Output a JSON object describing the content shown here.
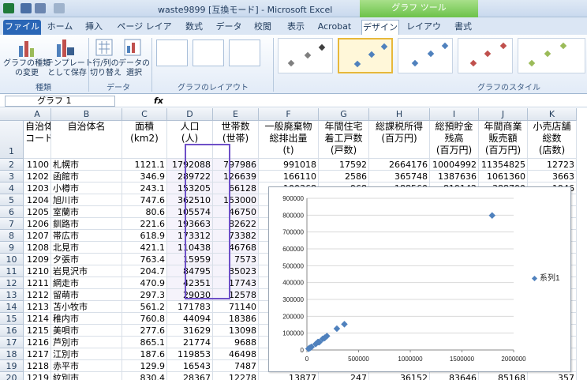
{
  "window": {
    "title": "waste9899 [互換モード] - Microsoft Excel",
    "chart_tools": "グラフ ツール"
  },
  "tabs": [
    "ファイル",
    "ホーム",
    "挿入",
    "ページ レイアウト",
    "数式",
    "データ",
    "校閲",
    "表示",
    "Acrobat",
    "デザイン",
    "レイアウト",
    "書式"
  ],
  "ribbon": {
    "change_type": "グラフの種類\nの変更",
    "save_template": "テンプレート\nとして保存",
    "type_group": "種類",
    "switch_rowcol": "行/列の\n切り替え",
    "select_data": "データの\n選択",
    "data_group": "データ",
    "layout_group": "グラフのレイアウト",
    "style_group": "グラフのスタイル"
  },
  "formula_bar": {
    "name_box": "グラフ 1",
    "fx": "fx"
  },
  "columns": [
    "A",
    "B",
    "C",
    "D",
    "E",
    "F",
    "G",
    "H",
    "I",
    "J",
    "K"
  ],
  "header_row": [
    "自治体\nコード",
    "自治体名",
    "面積\n(km2)",
    "人口\n(人)",
    "世帯数\n(世帯)",
    "一般廃棄物\n総排出量\n(t)",
    "年間住宅\n着工戸数\n(戸数)",
    "総課税所得\n(百万円)",
    "総預貯金\n残高\n(百万円)",
    "年間商業\n販売額\n(百万円)",
    "小売店舗\n総数\n(店数)"
  ],
  "rows": [
    [
      "1100",
      "札幌市",
      "1121.1",
      "1792088",
      "797986",
      "991018",
      "17592",
      "2664176",
      "10004992",
      "11354825",
      "12723"
    ],
    [
      "1202",
      "函館市",
      "346.9",
      "289722",
      "126639",
      "166110",
      "2586",
      "365748",
      "1387636",
      "1061360",
      "3663"
    ],
    [
      "1203",
      "小樽市",
      "243.1",
      "153205",
      "66128",
      "100368",
      "968",
      "188560",
      "819142",
      "388700",
      "1946"
    ],
    [
      "1204",
      "旭川市",
      "747.6",
      "362510",
      "153000",
      "",
      "",
      "",
      "",
      "",
      ""
    ],
    [
      "1205",
      "室蘭市",
      "80.6",
      "105574",
      "46750",
      "",
      "",
      "",
      "",
      "",
      ""
    ],
    [
      "1206",
      "釧路市",
      "221.6",
      "193663",
      "82622",
      "",
      "",
      "",
      "",
      "",
      ""
    ],
    [
      "1207",
      "帯広市",
      "618.9",
      "173312",
      "73382",
      "",
      "",
      "",
      "",
      "",
      ""
    ],
    [
      "1208",
      "北見市",
      "421.1",
      "110438",
      "46768",
      "",
      "",
      "",
      "",
      "",
      ""
    ],
    [
      "1209",
      "夕張市",
      "763.4",
      "15959",
      "7573",
      "",
      "",
      "",
      "",
      "",
      ""
    ],
    [
      "1210",
      "岩見沢市",
      "204.7",
      "84795",
      "35023",
      "",
      "",
      "",
      "",
      "",
      ""
    ],
    [
      "1211",
      "網走市",
      "470.9",
      "42351",
      "17743",
      "",
      "",
      "",
      "",
      "",
      ""
    ],
    [
      "1212",
      "留萌市",
      "297.3",
      "29030",
      "12578",
      "",
      "",
      "",
      "",
      "",
      ""
    ],
    [
      "1213",
      "苫小牧市",
      "561.2",
      "171783",
      "71140",
      "",
      "",
      "",
      "",
      "",
      ""
    ],
    [
      "1214",
      "稚内市",
      "760.8",
      "44094",
      "18386",
      "",
      "",
      "",
      "",
      "",
      ""
    ],
    [
      "1215",
      "美唄市",
      "277.6",
      "31629",
      "13098",
      "",
      "",
      "",
      "",
      "",
      ""
    ],
    [
      "1216",
      "芦別市",
      "865.1",
      "21774",
      "9688",
      "",
      "",
      "",
      "",
      "",
      ""
    ],
    [
      "1217",
      "江別市",
      "187.6",
      "119853",
      "46498",
      "",
      "",
      "",
      "",
      "",
      ""
    ],
    [
      "1218",
      "赤平市",
      "129.9",
      "16543",
      "7487",
      "",
      "",
      "",
      "",
      "",
      ""
    ],
    [
      "1219",
      "紋別市",
      "830.4",
      "28367",
      "12278",
      "13877",
      "247",
      "36152",
      "83646",
      "85168",
      "357"
    ]
  ],
  "chart_data": {
    "type": "scatter",
    "series": [
      {
        "name": "系列1",
        "x": [
          1792088,
          289722,
          153205,
          362510,
          105574,
          193663,
          173312,
          110438,
          15959,
          84795,
          42351,
          29030,
          171783,
          44094,
          31629,
          21774,
          119853,
          16543
        ],
        "y": [
          797986,
          126639,
          66128,
          153000,
          46750,
          82622,
          73382,
          46768,
          7573,
          35023,
          17743,
          12578,
          71140,
          18386,
          13098,
          9688,
          46498,
          7487
        ]
      }
    ],
    "xlim": [
      0,
      2000000
    ],
    "ylim": [
      0,
      900000
    ],
    "x_ticks": [
      "0",
      "500000",
      "1000000",
      "1500000",
      "2000000"
    ],
    "y_ticks": [
      "0",
      "100000",
      "200000",
      "300000",
      "400000",
      "500000",
      "600000",
      "700000",
      "800000",
      "900000"
    ],
    "legend": "right",
    "marker_color": "#4f81bd"
  }
}
